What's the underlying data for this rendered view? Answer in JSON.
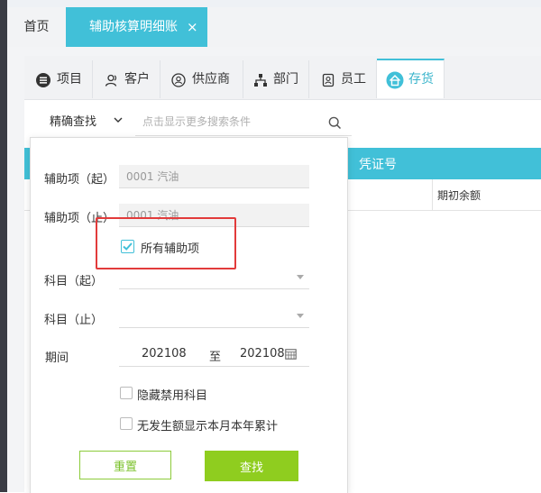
{
  "top_tabs": {
    "home": "首页",
    "active": "辅助核算明细账",
    "close": "×"
  },
  "sub_tabs": [
    {
      "label": "项目",
      "icon": "list-icon"
    },
    {
      "label": "客户",
      "icon": "user-icon"
    },
    {
      "label": "供应商",
      "icon": "supplier-icon"
    },
    {
      "label": "部门",
      "icon": "org-icon"
    },
    {
      "label": "员工",
      "icon": "badge-icon"
    },
    {
      "label": "存货",
      "icon": "inventory-home-icon"
    }
  ],
  "search": {
    "mode": "精确查找",
    "placeholder": "点击显示更多搜索条件"
  },
  "table": {
    "header": "凭证号",
    "column": "期初余额"
  },
  "filter": {
    "aux_from_label": "辅助项（起）",
    "aux_from_value": "0001 汽油",
    "aux_to_label": "辅助项（止）",
    "aux_to_value": "0001 汽油",
    "all_aux_label": "所有辅助项",
    "all_aux_checked": true,
    "subject_from_label": "科目（起）",
    "subject_to_label": "科目（止）",
    "period_label": "期间",
    "period_from": "202108",
    "period_sep": "至",
    "period_to": "202108",
    "hide_disabled_label": "隐藏禁用科目",
    "no_amount_label": "无发生额显示本月本年累计",
    "reset_label": "重置",
    "search_label": "查找"
  },
  "colors": {
    "accent": "#41c0d8",
    "green": "#8fcd1f",
    "highlight_border": "#e23b3b"
  }
}
